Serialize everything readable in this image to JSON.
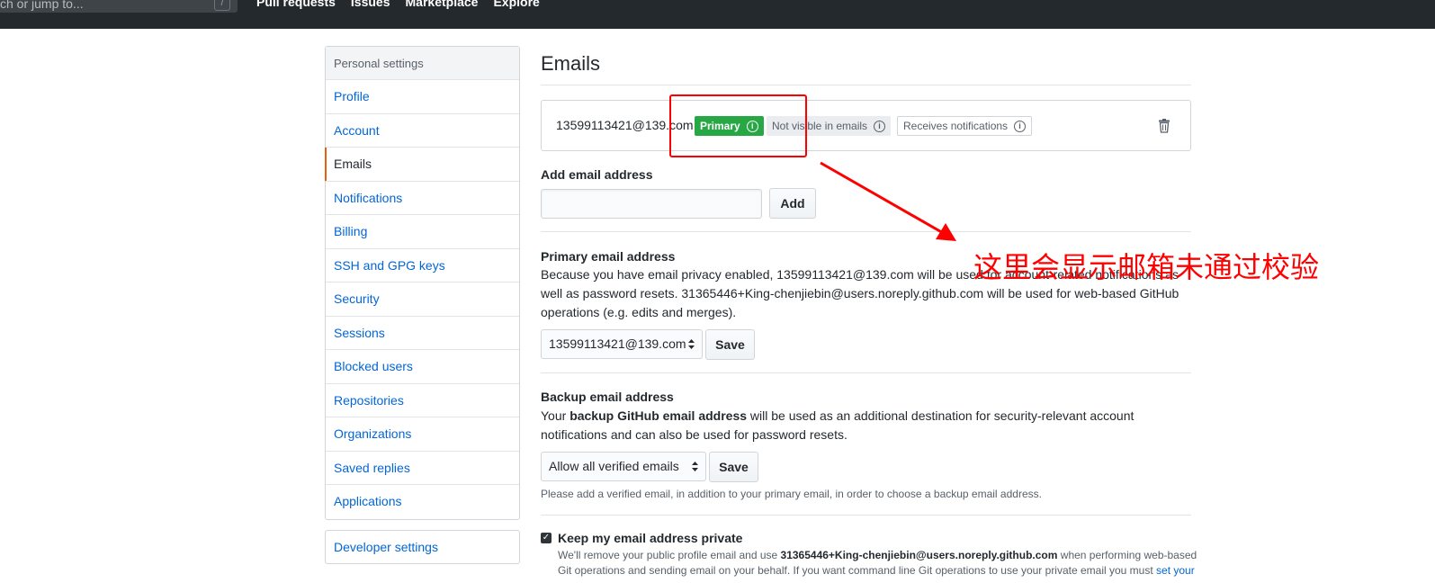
{
  "header": {
    "search_placeholder": "ch or jump to...",
    "search_shortcut": "/",
    "nav": [
      "Pull requests",
      "Issues",
      "Marketplace",
      "Explore"
    ]
  },
  "sidebar": {
    "heading": "Personal settings",
    "items": [
      {
        "label": "Profile"
      },
      {
        "label": "Account"
      },
      {
        "label": "Emails",
        "active": true
      },
      {
        "label": "Notifications"
      },
      {
        "label": "Billing"
      },
      {
        "label": "SSH and GPG keys"
      },
      {
        "label": "Security"
      },
      {
        "label": "Sessions"
      },
      {
        "label": "Blocked users"
      },
      {
        "label": "Repositories"
      },
      {
        "label": "Organizations"
      },
      {
        "label": "Saved replies"
      },
      {
        "label": "Applications"
      }
    ],
    "developer_settings": "Developer settings"
  },
  "main": {
    "title": "Emails",
    "email_entry": {
      "address": "13599113421@139.com",
      "primary_label": "Primary",
      "not_visible_label": "Not visible in emails",
      "notifications_label": "Receives notifications",
      "info_glyph": "i"
    },
    "add_email": {
      "title": "Add email address",
      "input_value": "",
      "button": "Add"
    },
    "primary_email": {
      "title": "Primary email address",
      "description": "Because you have email privacy enabled, 13599113421@139.com will be used for account-related notifications as well as password resets. 31365446+King-chenjiebin@users.noreply.github.com will be used for web-based GitHub operations (e.g. edits and merges).",
      "select_value": "13599113421@139.com",
      "button": "Save"
    },
    "backup_email": {
      "title": "Backup email address",
      "desc_prefix": "Your ",
      "desc_bold": "backup GitHub email address",
      "desc_suffix": " will be used as an additional destination for security-relevant account notifications and can also be used for password resets.",
      "select_value": "Allow all verified emails",
      "button": "Save",
      "note": "Please add a verified email, in addition to your primary email, in order to choose a backup email address."
    },
    "keep_private": {
      "title": "Keep my email address private",
      "checked": true,
      "desc_prefix": "We'll remove your public profile email and use ",
      "desc_bold": "31365446+King-chenjiebin@users.noreply.github.com",
      "desc_suffix": " when performing web-based",
      "desc_line2": "Git operations and sending email on your behalf. If you want command line Git operations to use your private email you must ",
      "desc_link": "set your"
    }
  },
  "annotation": {
    "text": "这里会显示邮箱未通过校验",
    "color": "#ff0000"
  },
  "colors": {
    "header_bg": "#24292e",
    "link": "#0366d6",
    "primary_green": "#28a745",
    "active_marker": "#e36209"
  }
}
